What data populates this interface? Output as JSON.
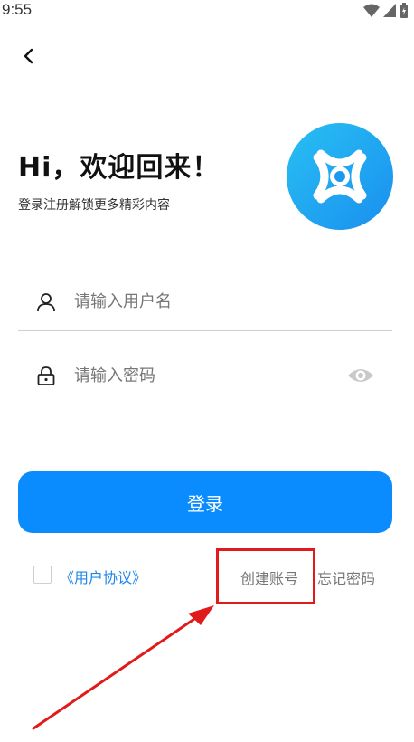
{
  "status_bar": {
    "time": "9:55"
  },
  "header": {
    "title": "Hi，欢迎回来！",
    "subtitle": "登录注册解锁更多精彩内容"
  },
  "form": {
    "username_placeholder": "请输入用户名",
    "password_placeholder": "请输入密码",
    "login_label": "登录"
  },
  "footer": {
    "agreement_label": "《用户协议》",
    "create_account_label": "创建账号",
    "forgot_password_label": "忘记密码"
  },
  "colors": {
    "accent": "#0a8cff",
    "highlight": "#e11b1b",
    "logo_start": "#28c0f2",
    "logo_end": "#1a8ff0"
  },
  "icons": [
    "wifi-icon",
    "signal-icon",
    "battery-icon",
    "back-arrow-icon",
    "app-logo-icon",
    "user-icon",
    "lock-icon",
    "eye-icon"
  ]
}
